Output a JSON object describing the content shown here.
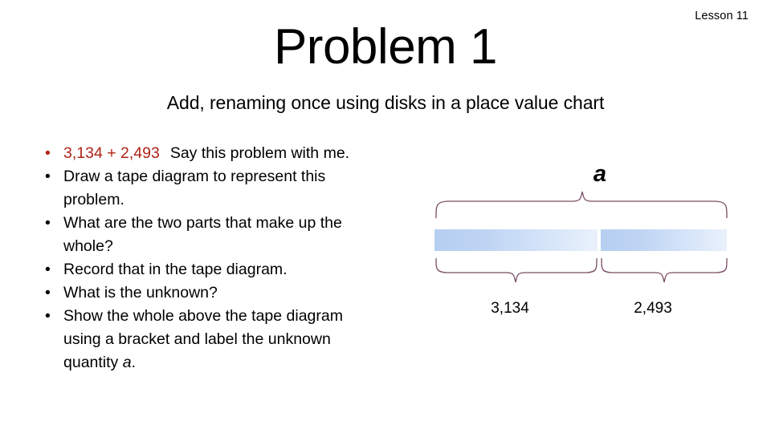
{
  "slide": {
    "lesson_label": "Lesson 11",
    "title": "Problem 1",
    "subtitle": "Add, renaming once using disks in a place value chart"
  },
  "bullets": [
    {
      "accent_text": "3,134 + 2,493",
      "text": "Say this problem with me."
    },
    {
      "accent_text": "",
      "text": "Draw a tape diagram to represent this problem."
    },
    {
      "accent_text": "",
      "text": "What are the two parts that make up the whole?"
    },
    {
      "accent_text": "",
      "text": "Record that in the tape diagram."
    },
    {
      "accent_text": "",
      "text": "What is the unknown?"
    },
    {
      "accent_text": "",
      "text": "Show the whole above the tape diagram using a bracket and label the unknown quantity ",
      "italic_tail": "a",
      "tail": "."
    }
  ],
  "bullet_marker": "•",
  "tape_diagram": {
    "whole_label": "a",
    "parts": [
      {
        "label": "3,134"
      },
      {
        "label": "2,493"
      }
    ]
  },
  "colors": {
    "accent_red": "#b02418",
    "brace": "#7a4d64",
    "bar_start": "#b5cff2",
    "bar_end": "#eaf1fc",
    "text": "#000000",
    "background": "#ffffff"
  }
}
